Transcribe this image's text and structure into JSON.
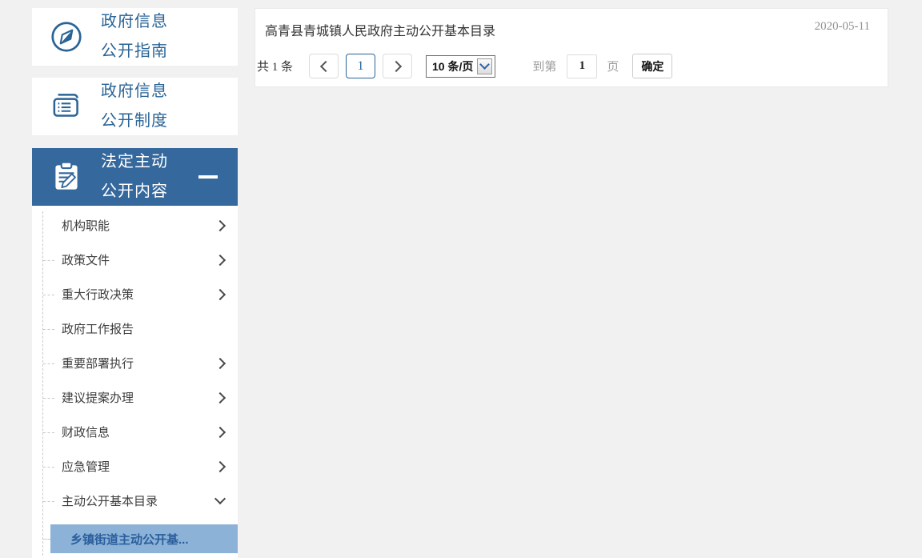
{
  "colors": {
    "page_background": "#f1f1f2",
    "accent_blue": "#2a6496",
    "active_card_background": "#35689d",
    "active_submenu_background": "#8cb2d8",
    "active_submenu_text": "#2a5e9c",
    "date_gray": "#8f8f8f"
  },
  "sidebar": {
    "cards": [
      {
        "icon": "compass-icon",
        "label_line1": "政府信息",
        "label_line2": "公开指南",
        "active": false
      },
      {
        "icon": "book-icon",
        "label_line1": "政府信息",
        "label_line2": "公开制度",
        "active": false
      },
      {
        "icon": "clipboard-pen-icon",
        "label_line1": "法定主动",
        "label_line2": "公开内容",
        "active": true,
        "collapse_indicator": "minus-icon"
      }
    ],
    "submenu": {
      "items": [
        {
          "label": "机构职能",
          "chevron": "right"
        },
        {
          "label": "政策文件",
          "chevron": "right"
        },
        {
          "label": "重大行政决策",
          "chevron": "right"
        },
        {
          "label": "政府工作报告",
          "chevron": "none"
        },
        {
          "label": "重要部署执行",
          "chevron": "right"
        },
        {
          "label": "建议提案办理",
          "chevron": "right"
        },
        {
          "label": "财政信息",
          "chevron": "right"
        },
        {
          "label": "应急管理",
          "chevron": "right"
        },
        {
          "label": "主动公开基本目录",
          "chevron": "down",
          "expanded": true
        },
        {
          "label": "乡镇街道主动公开基...",
          "chevron": "none",
          "active": true
        }
      ]
    }
  },
  "content": {
    "list": [
      {
        "title": "高青县青城镇人民政府主动公开基本目录",
        "date": "2020-05-11"
      }
    ],
    "pagination": {
      "total_label": "共 1 条",
      "current_page": "1",
      "page_size_label": "10 条/页",
      "goto_prefix": "到第",
      "goto_value": "1",
      "goto_suffix": "页",
      "confirm_label": "确定"
    }
  }
}
